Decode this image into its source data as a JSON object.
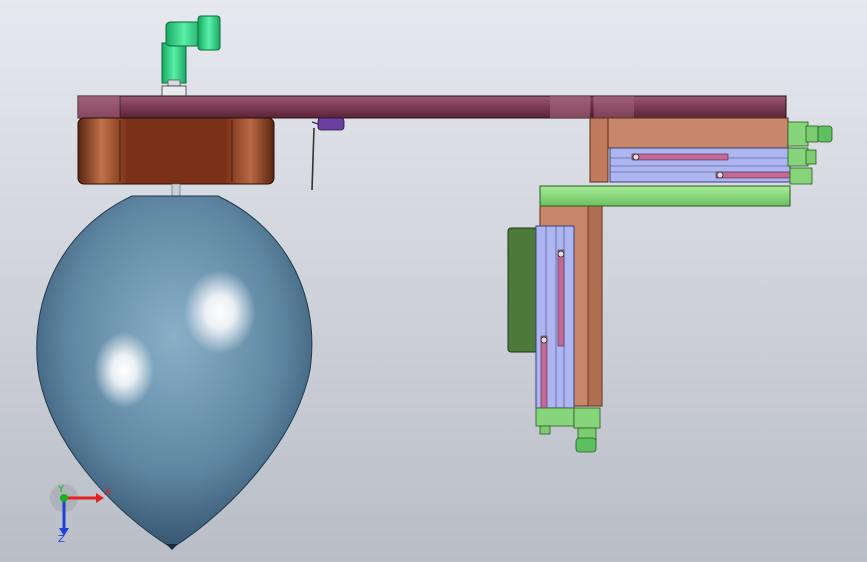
{
  "viewport": {
    "background_top": "#e6e9ef",
    "background_bottom": "#b9bdc6"
  },
  "triad": {
    "x_label": "X",
    "y_label": "Y",
    "z_label": "Z",
    "x_color": "#e52222",
    "y_color": "#19b21e",
    "z_color": "#2240d8"
  },
  "colors": {
    "plate": "#7a3b52",
    "copper": "#8a3c1d",
    "balloon": "#6f93ad",
    "cylinder_blue": "#aeb6f2",
    "green_part": "#86d57a",
    "dark_green_pad": "#4d7a3a",
    "bracket": "#c8866a",
    "rod_pink": "#b45a8a",
    "fitting_green": "#2ed88a",
    "purple_clip": "#6b3fa0"
  }
}
